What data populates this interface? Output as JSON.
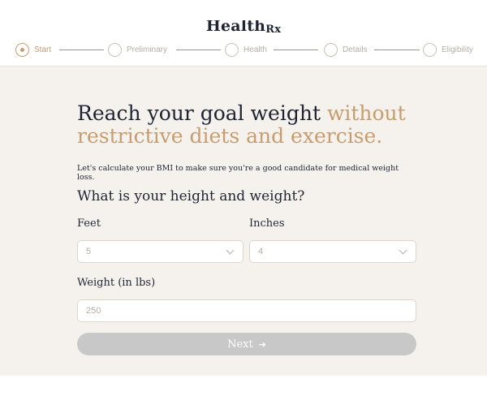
{
  "header": {
    "logo_text": "Health",
    "logo_suffix": "Rx",
    "steps": [
      {
        "label": "Start",
        "active": true
      },
      {
        "label": "Preliminary",
        "active": false
      },
      {
        "label": "Health",
        "active": false
      },
      {
        "label": "Details",
        "active": false
      },
      {
        "label": "Eligibility",
        "active": false
      }
    ]
  },
  "main": {
    "headline_primary": "Reach your goal weight ",
    "headline_accent": "without restrictive diets and exercise.",
    "subtext": "Let's calculate your BMI to make sure you're a good candidate for medical weight loss.",
    "question": "What is your height and weight?",
    "feet": {
      "label": "Feet",
      "value": "5",
      "icon": "chevron-down-icon"
    },
    "inches": {
      "label": "Inches",
      "value": "4",
      "icon": "chevron-down-icon"
    },
    "weight": {
      "label": "Weight (in lbs)",
      "placeholder": "250"
    },
    "next_button": {
      "label": "Next",
      "icon": "arrow-right-icon"
    }
  },
  "colors": {
    "accent": "#c79d6d",
    "text": "#1f2433",
    "background": "#f5f2ed",
    "button_disabled": "#c8c8c8"
  }
}
